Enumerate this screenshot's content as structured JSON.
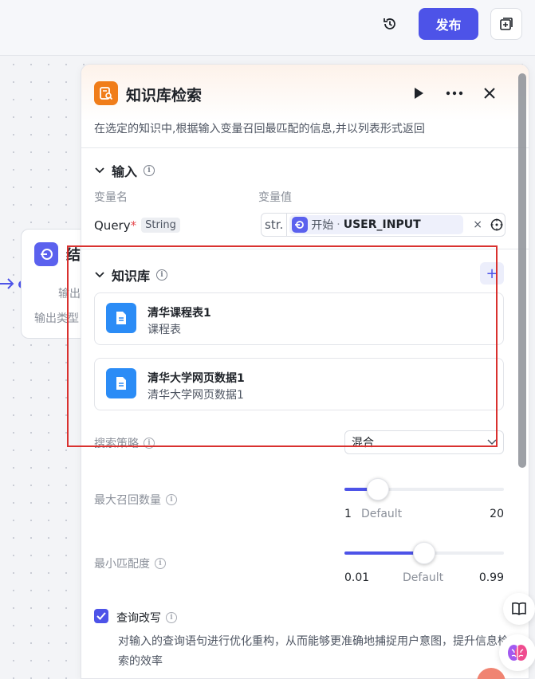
{
  "toolbar": {
    "publish_label": "发布",
    "history_icon": "history-icon",
    "add_icon": "add-copy-icon"
  },
  "end_node": {
    "title": "结",
    "output_label": "输出",
    "output_type_label": "输出类型"
  },
  "panel": {
    "title": "知识库检索",
    "description": "在选定的知识中,根据输入变量召回最匹配的信息,并以列表形式返回",
    "input_section": {
      "title": "输入",
      "col_name": "变量名",
      "col_value": "变量值",
      "param_name": "Query",
      "required_mark": "*",
      "param_type": "String",
      "value_prefix": "str.",
      "ref_node": "开始",
      "ref_sep": "·",
      "ref_var": "USER_INPUT"
    },
    "kb_section": {
      "title": "知识库",
      "items": [
        {
          "name": "清华课程表1",
          "desc": "课程表"
        },
        {
          "name": "清华大学网页数据1",
          "desc": "清华大学网页数据1"
        }
      ]
    },
    "settings": {
      "search_strategy_label": "搜索策略",
      "search_strategy_value": "混合",
      "max_recall_label": "最大召回数量",
      "max_recall": {
        "min": "1",
        "default_label": "Default",
        "max": "20",
        "value": 3,
        "fraction": 0.21
      },
      "min_match_label": "最小匹配度",
      "min_match": {
        "min": "0.01",
        "default_label": "Default",
        "max": "0.99",
        "value": 0.5,
        "fraction": 0.5
      },
      "query_rewrite_label": "查询改写",
      "query_rewrite_checked": true,
      "query_rewrite_desc": "对输入的查询语句进行优化重构，从而能够更准确地捕捉用户意图，提升信息检索的效率"
    }
  },
  "colors": {
    "accent": "#4d53e8",
    "kb_icon": "#f07d1a",
    "doc_icon": "#2b8cf6",
    "highlight_outline": "#d9312f"
  }
}
